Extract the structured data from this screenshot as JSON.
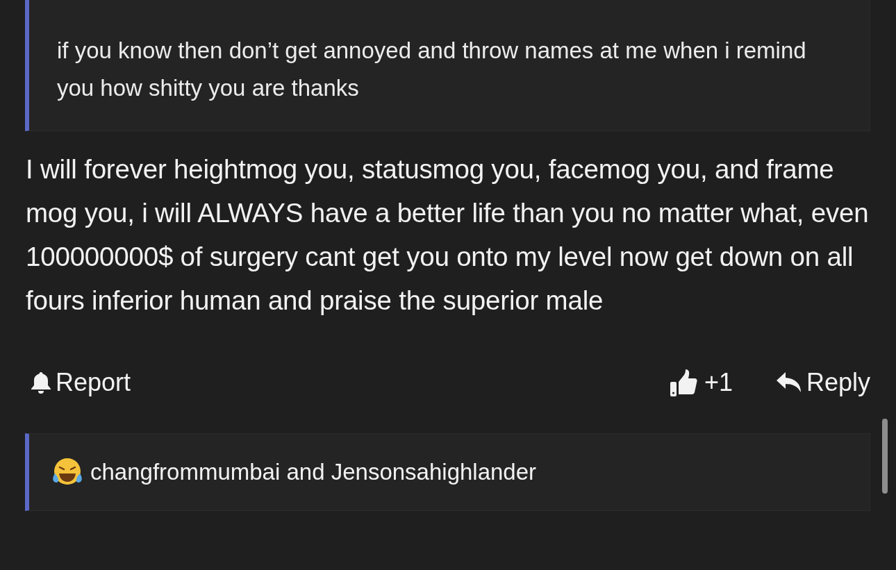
{
  "quote": {
    "text": "if you know then don’t get annoyed and throw names at me when i remind you how shitty you are thanks"
  },
  "post": {
    "text": "I will forever heightmog you, statusmog you, facemog you, and frame mog you, i will ALWAYS have a better life than you no matter what, even 100000000$ of surgery cant get you onto my level now get down on all fours inferior human and praise the superior male"
  },
  "actions": {
    "report": "Report",
    "likes": "+1",
    "reply": "Reply"
  },
  "reactions": {
    "names": "changfrommumbai and Jensonsahighlander"
  }
}
